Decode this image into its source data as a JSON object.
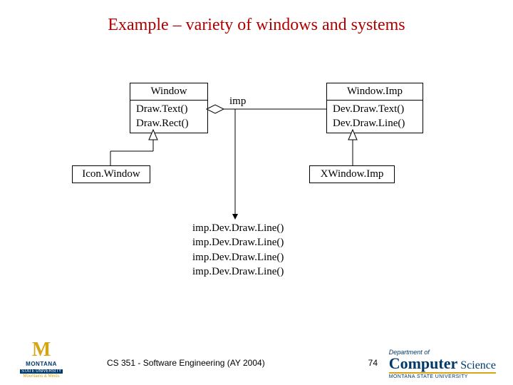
{
  "title": "Example – variety of windows and systems",
  "uml": {
    "window": {
      "name": "Window",
      "op1": "Draw.Text()",
      "op2": "Draw.Rect()"
    },
    "windowImp": {
      "name": "Window.Imp",
      "op1": "Dev.Draw.Text()",
      "op2": "Dev.Draw.Line()"
    },
    "iconWindow": {
      "name": "Icon.Window"
    },
    "xWindowImp": {
      "name": "XWindow.Imp"
    },
    "assocLabel": "imp"
  },
  "code": {
    "line1": "imp.Dev.Draw.Line()",
    "line2": "imp.Dev.Draw.Line()",
    "line3": "imp.Dev.Draw.Line()",
    "line4": "imp.Dev.Draw.Line()"
  },
  "footer": {
    "course": "CS 351 - Software Engineering (AY 2004)",
    "page": "74",
    "msu": {
      "letter": "M",
      "name": "MONTANA",
      "state": "STATE UNIVERSITY",
      "tag": "Mountains & Minds"
    },
    "cs": {
      "dept": "Department of",
      "big": "Computer",
      "small": " Science",
      "sub": "MONTANA STATE UNIVERSITY"
    }
  }
}
